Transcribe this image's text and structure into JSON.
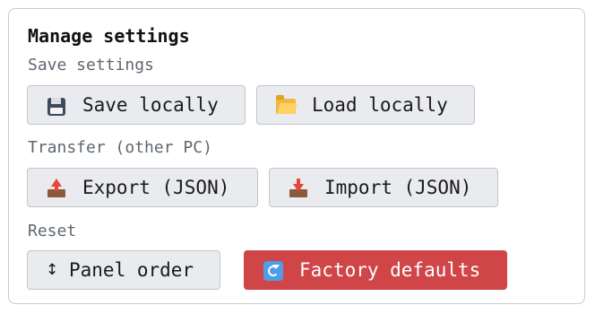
{
  "panel": {
    "title": "Manage settings"
  },
  "sections": {
    "save": {
      "label": "Save settings",
      "save_locally": {
        "label": "Save locally",
        "icon": "floppy-disk-icon"
      },
      "load_locally": {
        "label": "Load locally",
        "icon": "open-folder-icon"
      }
    },
    "transfer": {
      "label": "Transfer (other PC)",
      "export": {
        "label": "Export (JSON)",
        "icon": "outbox-tray-icon"
      },
      "import": {
        "label": "Import (JSON)",
        "icon": "inbox-tray-icon"
      }
    },
    "reset": {
      "label": "Reset",
      "panel_order": {
        "label": "Panel order",
        "icon": "up-down-arrow-icon",
        "glyph": "↕"
      },
      "factory_defaults": {
        "label": "Factory defaults",
        "icon": "refresh-icon"
      }
    }
  },
  "colors": {
    "button_bg": "#e9ebee",
    "button_border": "#c2c6cc",
    "danger_bg": "#cf4548",
    "label_text": "#5f6770"
  }
}
